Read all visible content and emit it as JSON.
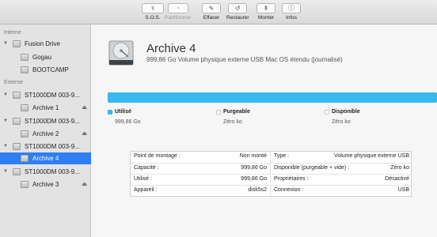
{
  "toolbar": {
    "buttons": [
      {
        "label": "S.O.S.",
        "icon": "stethoscope-icon",
        "glyph": "⚕"
      },
      {
        "label": "Partitionner",
        "icon": "partition-icon",
        "glyph": "◔"
      },
      {
        "label": "Effacer",
        "icon": "erase-icon",
        "glyph": "✎"
      },
      {
        "label": "Restaurer",
        "icon": "restore-icon",
        "glyph": "↺"
      },
      {
        "label": "Monter",
        "icon": "mount-icon",
        "glyph": "⇞"
      },
      {
        "label": "Infos",
        "icon": "info-icon",
        "glyph": "ⓘ"
      }
    ]
  },
  "sidebar": {
    "internal_header": "Interne",
    "external_header": "Externe",
    "items": [
      {
        "label": "Fusion Drive"
      },
      {
        "label": "Gogau"
      },
      {
        "label": "BOOTCAMP"
      },
      {
        "label": "ST1000DM 003-9..."
      },
      {
        "label": "Archive 1"
      },
      {
        "label": "ST1000DM 003-9..."
      },
      {
        "label": "Archive 2"
      },
      {
        "label": "ST1000DM 003-9..."
      },
      {
        "label": "Archive 4"
      },
      {
        "label": "ST1000DM 003-9..."
      },
      {
        "label": "Archive 3"
      }
    ],
    "eject_glyph": "⏏",
    "triangle_glyph": "▼"
  },
  "volume": {
    "name": "Archive 4",
    "description": "999,86 Go Volume physique externe USB Mac OS étendu (journalisé)"
  },
  "usage": {
    "bar_color": "#37b8ee",
    "used_fraction": 1.0,
    "legend": [
      {
        "name": "Utilisé",
        "value": "999,86 Go",
        "color": "#37b8ee"
      },
      {
        "name": "Purgeable",
        "value": "Zéro ko",
        "color": "#ffffff"
      },
      {
        "name": "Disponible",
        "value": "Zéro ko",
        "color": "#ffffff"
      }
    ]
  },
  "info": {
    "left": [
      {
        "key": "Point de montage :",
        "value": "Non monté"
      },
      {
        "key": "Capacité :",
        "value": "999,86 Go"
      },
      {
        "key": "Utilisé :",
        "value": "999,86 Go"
      },
      {
        "key": "Appareil :",
        "value": "disk5s2"
      }
    ],
    "right": [
      {
        "key": "Type :",
        "value": "Volume physique externe USB"
      },
      {
        "key": "Disponible (purgeable + vide) :",
        "value": "Zéro ko"
      },
      {
        "key": "Propriétaires :",
        "value": "Désactivé"
      },
      {
        "key": "Connexion :",
        "value": "USB"
      }
    ]
  }
}
